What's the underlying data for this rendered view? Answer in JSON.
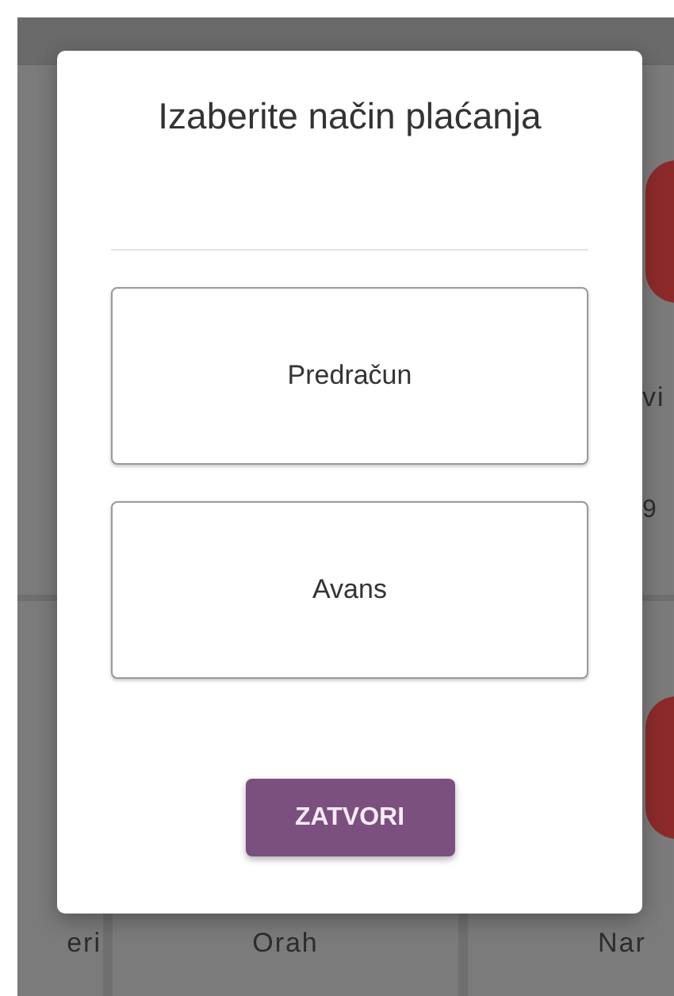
{
  "background": {
    "products": [
      {
        "name": "vi",
        "price": "9"
      },
      {
        "name": "eri"
      },
      {
        "name": "Orah"
      },
      {
        "name": "Nar"
      }
    ]
  },
  "dialog": {
    "title": "Izaberite način plaćanja",
    "options": [
      "Predračun",
      "Avans"
    ],
    "close_button": "ZATVORI"
  }
}
